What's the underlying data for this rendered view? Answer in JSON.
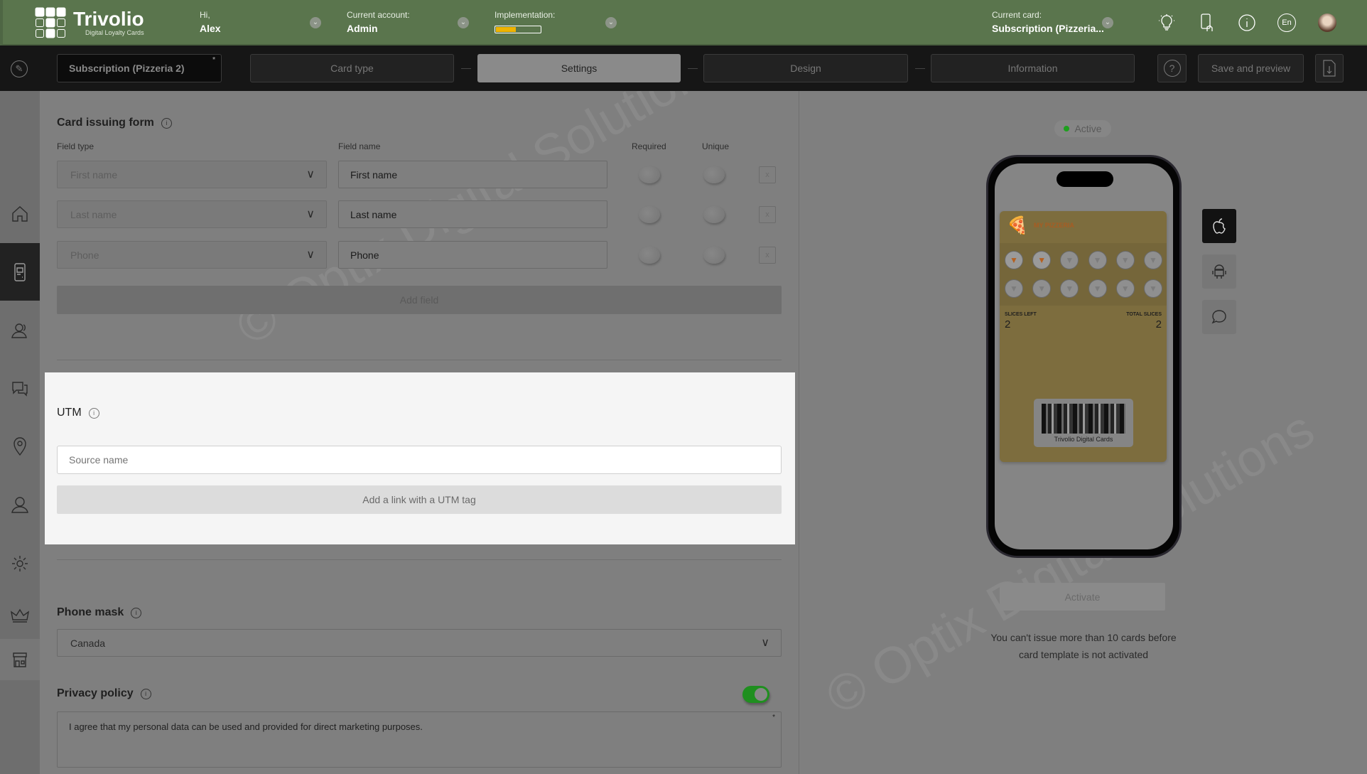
{
  "header": {
    "logo_text": "Trivolio",
    "logo_subtitle": "Digital Loyalty Cards",
    "greeting_label": "Hi,",
    "user_name": "Alex",
    "account_label": "Current account:",
    "account_value": "Admin",
    "implementation_label": "Implementation:",
    "implementation_progress_percent": 45,
    "implementation_color": "#f0b400",
    "current_card_label": "Current card:",
    "current_card_value": "Subscription (Pizzeria...",
    "icons": [
      "lightbulb-icon",
      "phone-icon",
      "info-icon",
      "language-icon",
      "avatar"
    ],
    "language": "En"
  },
  "toolbar": {
    "card_name": "Subscription (Pizzeria 2)",
    "required_mark": "*",
    "tabs": [
      {
        "label": "Card type",
        "active": false
      },
      {
        "label": "Settings",
        "active": true
      },
      {
        "label": "Design",
        "active": false
      },
      {
        "label": "Information",
        "active": false
      }
    ],
    "help": "?",
    "save_label": "Save and preview"
  },
  "sidebar": {
    "items": [
      "home",
      "cards",
      "customers",
      "messages",
      "locations",
      "users",
      "settings",
      "subscription",
      "shop"
    ],
    "active": "cards"
  },
  "form": {
    "title": "Card issuing form",
    "col_field_type": "Field type",
    "col_field_name": "Field name",
    "col_required": "Required",
    "col_unique": "Unique",
    "rows": [
      {
        "type": "First name",
        "name": "First name",
        "required": false,
        "unique": false
      },
      {
        "type": "Last name",
        "name": "Last name",
        "required": false,
        "unique": false
      },
      {
        "type": "Phone",
        "name": "Phone",
        "required": false,
        "unique": false
      }
    ],
    "remove_label": "x",
    "add_field_label": "Add field"
  },
  "utm": {
    "title": "UTM",
    "source_placeholder": "Source name",
    "add_link_label": "Add a link with a UTM tag"
  },
  "phone_mask": {
    "title": "Phone mask",
    "value": "Canada"
  },
  "privacy": {
    "title": "Privacy policy",
    "enabled": true,
    "toggle_color": "#1f8f1f",
    "text": "I agree that my personal data can be used and provided for direct marketing purposes.",
    "required_mark": "*"
  },
  "preview": {
    "status": "Active",
    "status_color": "#1ea01e",
    "card": {
      "brand": "MY PIZZERIA",
      "stamps_total": 12,
      "stamps_filled": 2,
      "left_label": "SLICES LEFT",
      "left_value": "2",
      "right_label": "TOTAL SLICES",
      "right_value": "2",
      "barcode_caption": "Trivolio Digital Cards",
      "color": "#7d6d3e"
    },
    "platforms": [
      "apple-icon",
      "android-icon",
      "chat-icon"
    ],
    "activate_label": "Activate",
    "notice": "You can't issue more than 10 cards before card template is not activated"
  },
  "watermark": "© Optix Digital Solutions"
}
